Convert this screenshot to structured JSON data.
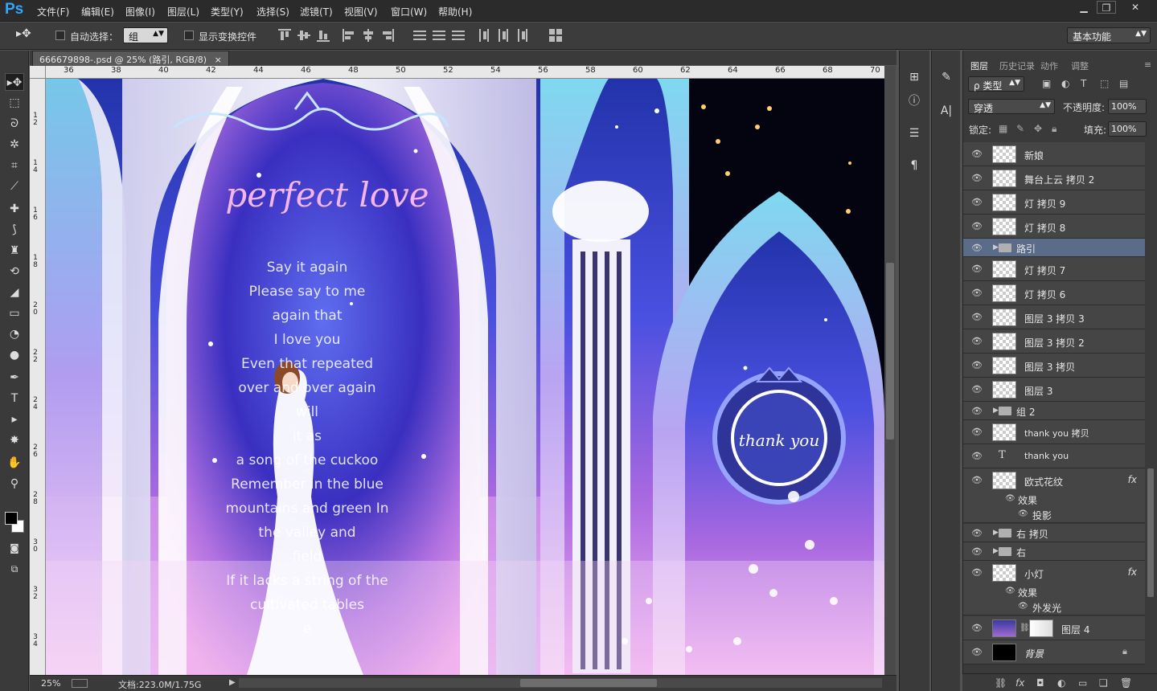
{
  "app": {
    "logo": "Ps"
  },
  "menu": [
    "文件(F)",
    "编辑(E)",
    "图像(I)",
    "图层(L)",
    "类型(Y)",
    "选择(S)",
    "滤镜(T)",
    "视图(V)",
    "窗口(W)",
    "帮助(H)"
  ],
  "window_controls": {
    "minimize": "▁",
    "restore": "❐",
    "close": "✕"
  },
  "options": {
    "auto_select_label": "自动选择：",
    "auto_select_value": "组",
    "show_transform_label": "显示变换控件",
    "workspace": "基本功能"
  },
  "document": {
    "tab_title": "666679898-.psd @ 25% (路引, RGB/8)",
    "tab_close": "×",
    "zoom": "25%",
    "doc_info": "文档:223.0M/1.75G"
  },
  "ruler": {
    "h_labels": [
      "36",
      "38",
      "40",
      "42",
      "44",
      "46",
      "48",
      "50",
      "52",
      "54",
      "56",
      "58",
      "60",
      "62",
      "64",
      "66",
      "68",
      "70"
    ],
    "v_labels": [
      "1 2",
      "1 4",
      "1 6",
      "1 8",
      "2 0",
      "2 2",
      "2 4",
      "2 6",
      "2 8",
      "3 0",
      "3 2",
      "3 4"
    ]
  },
  "artwork": {
    "script_title": "perfect love",
    "poem_lines": [
      "Say it again",
      "Please say to me",
      "again that",
      "I love you",
      "Even that repeated",
      "over and over again",
      "will",
      "it as",
      "a song of the cuckoo",
      "Remember in the blue",
      "mountains and green In",
      "the valley and",
      "field",
      "If it lacks a string of the",
      "cultivated tables",
      "e"
    ],
    "badge_text": "thank you"
  },
  "layers_panel": {
    "tabs": [
      "图层",
      "历史记录",
      "动作",
      "调整"
    ],
    "filter_kind": "ρ 类型",
    "blend_mode": "穿透",
    "opacity_label": "不透明度:",
    "opacity_value": "100%",
    "lock_label": "锁定:",
    "fill_label": "填充:",
    "fill_value": "100%",
    "layers": [
      {
        "name": "新娘",
        "kind": "pixel"
      },
      {
        "name": "舞台上云 拷贝 2",
        "kind": "pixel"
      },
      {
        "name": "灯 拷贝 9",
        "kind": "pixel"
      },
      {
        "name": "灯 拷贝 8",
        "kind": "pixel"
      },
      {
        "name": "路引",
        "kind": "group",
        "selected": true
      },
      {
        "name": "灯 拷贝 7",
        "kind": "pixel"
      },
      {
        "name": "灯 拷贝 6",
        "kind": "pixel"
      },
      {
        "name": "图层 3 拷贝 3",
        "kind": "pixel"
      },
      {
        "name": "图层 3 拷贝 2",
        "kind": "pixel"
      },
      {
        "name": "图层 3 拷贝",
        "kind": "pixel"
      },
      {
        "name": "图层 3",
        "kind": "pixel"
      },
      {
        "name": "组 2",
        "kind": "group"
      },
      {
        "name": "thank you  拷贝",
        "kind": "pixel"
      },
      {
        "name": "thank you",
        "kind": "text"
      },
      {
        "name": "欧式花纹",
        "kind": "pixel",
        "fx": "fx",
        "effects_label": "效果",
        "effect": "投影"
      },
      {
        "name": "右 拷贝",
        "kind": "group"
      },
      {
        "name": "右",
        "kind": "group"
      },
      {
        "name": "小灯",
        "kind": "pixel",
        "fx": "fx",
        "effects_label": "效果",
        "effect": "外发光"
      },
      {
        "name": "图层 4",
        "kind": "masked"
      },
      {
        "name": "背景",
        "kind": "background"
      }
    ]
  },
  "colors": {
    "ui_dark": "#2b2b2b",
    "panel": "#3a3a3a",
    "selection": "#5a6c8a",
    "accent": "#31a8ff"
  }
}
